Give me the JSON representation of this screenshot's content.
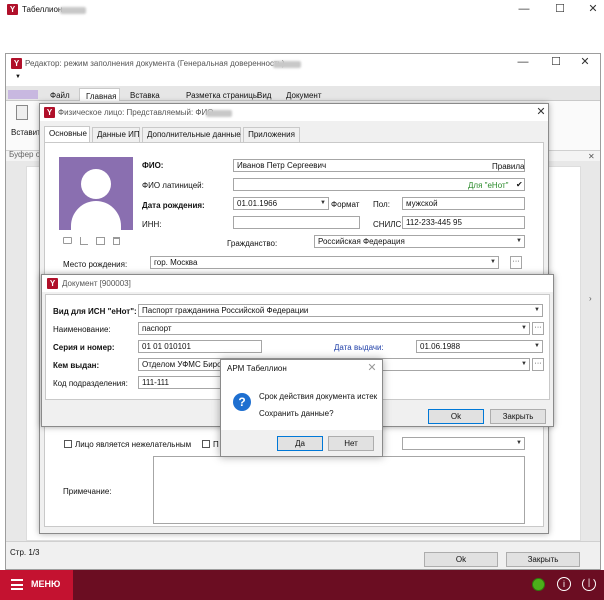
{
  "main_window": {
    "title": "Табеллион",
    "title_blur": true
  },
  "editor": {
    "title": "Редактор: режим заполнения документа (Генеральная доверенность)",
    "ribbon_tabs": [
      "Файл",
      "Главная",
      "Вставка",
      "Разметка страницы",
      "Вид",
      "Документ"
    ],
    "paste_label": "Вставит",
    "buffer_label": "Буфер о",
    "page_status": "Стр. 1/3",
    "ok": "Ok",
    "close": "Закрыть"
  },
  "person_dialog": {
    "title": "Физическое лицо: Представляемый: ФИО",
    "tabs": [
      "Основные",
      "Данные ИП",
      "Дополнительные данные",
      "Приложения"
    ],
    "fio_label": "ФИО:",
    "fio_value": "Иванов Петр Сергеевич",
    "rules_label": "Правила",
    "fio_latin_label": "ФИО латиницей:",
    "enot_hint": "Для \"еНот\"",
    "check_mark": "✔",
    "birth_label": "Дата рождения:",
    "birth_value": "01.01.1966",
    "format_label": "Формат",
    "sex_label": "Пол:",
    "sex_value": "мужской",
    "inn_label": "ИНН:",
    "snils_label": "СНИЛС:",
    "snils_value": "112-233-445 95",
    "citizenship_label": "Гражданство:",
    "citizenship_value": "Российская Федерация",
    "birthplace_label": "Место рождения:",
    "birthplace_value": "гор. Москва",
    "incapable_label": "Лицо является нежелательным",
    "second_check_label": "П",
    "note_label": "Примечание:"
  },
  "doc_dialog": {
    "title": "Документ [900003]",
    "kind_label": "Вид для ИСН \"еНот\":",
    "kind_value": "Паспорт гражданина Российской Федерации",
    "name_label": "Наименование:",
    "name_value": "паспорт",
    "series_label": "Серия и номер:",
    "series_value": "01 01 010101",
    "issue_date_label": "Дата выдачи:",
    "issue_date_value": "01.06.1988",
    "issued_by_label": "Кем выдан:",
    "issued_by_value": "Отделом УФМС Бирол",
    "code_label": "Код подразделения:",
    "code_value": "111-111",
    "ok": "Ok",
    "close": "Закрыть"
  },
  "msgbox": {
    "title": "АРМ Табеллион",
    "line1": "Срок действия документа истек",
    "line2": "Сохранить данные?",
    "yes": "Да",
    "no": "Нет"
  },
  "taskbar": {
    "menu_label": "МЕНЮ"
  },
  "colors": {
    "accent_red": "#c41230",
    "taskbar_dark": "#6b0d22",
    "tab_purple": "#8a6fb0",
    "status_green": "#4caf1a"
  }
}
